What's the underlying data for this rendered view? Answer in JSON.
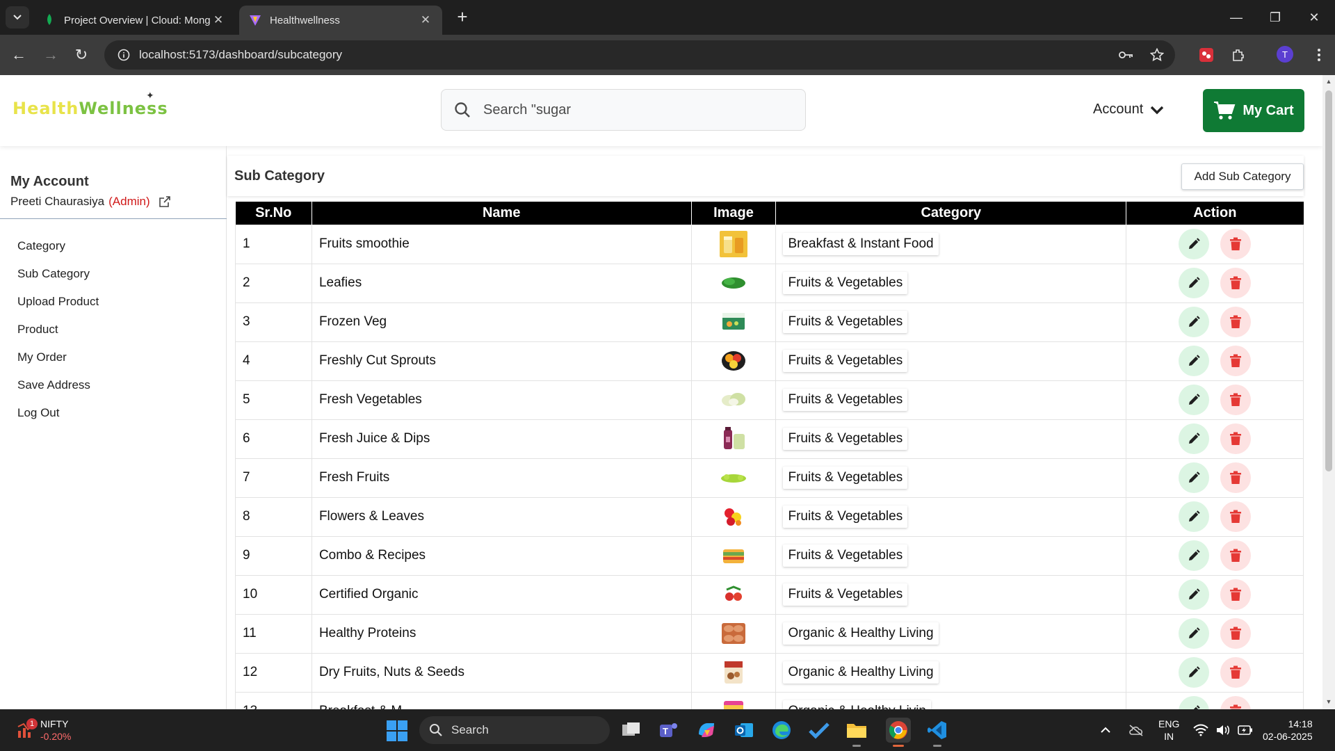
{
  "browser": {
    "tabs": [
      {
        "title": "Project Overview | Cloud: Mong",
        "active": false
      },
      {
        "title": "Healthwellness",
        "active": true
      }
    ],
    "url": "localhost:5173/dashboard/subcategory",
    "profile_initial": "T"
  },
  "header": {
    "logo_part1": "Health",
    "logo_part2": "Wellness",
    "search_placeholder": "Search \"sugar",
    "account_label": "Account",
    "cart_label": "My Cart"
  },
  "sidebar": {
    "title": "My Account",
    "user_name": "Preeti Chaurasiya",
    "user_role": "(Admin)",
    "items": [
      "Category",
      "Sub Category",
      "Upload Product",
      "Product",
      "My Order",
      "Save Address",
      "Log Out"
    ]
  },
  "main": {
    "title": "Sub Category",
    "add_button": "Add Sub Category",
    "columns": [
      "Sr.No",
      "Name",
      "Image",
      "Category",
      "Action"
    ],
    "rows": [
      {
        "sr": "1",
        "name": "Fruits smoothie",
        "category": "Breakfast & Instant Food",
        "image": "smoothie-glasses-image"
      },
      {
        "sr": "2",
        "name": "Leafies",
        "category": "Fruits & Vegetables",
        "image": "leafy-greens-image"
      },
      {
        "sr": "3",
        "name": "Frozen Veg",
        "category": "Fruits & Vegetables",
        "image": "frozen-veg-pack-image"
      },
      {
        "sr": "4",
        "name": "Freshly Cut Sprouts",
        "category": "Fruits & Vegetables",
        "image": "cut-sprouts-image"
      },
      {
        "sr": "5",
        "name": "Fresh Vegetables",
        "category": "Fruits & Vegetables",
        "image": "fresh-vegetables-image"
      },
      {
        "sr": "6",
        "name": "Fresh Juice & Dips",
        "category": "Fruits & Vegetables",
        "image": "juice-bottles-image"
      },
      {
        "sr": "7",
        "name": "Fresh Fruits",
        "category": "Fruits & Vegetables",
        "image": "grapes-image"
      },
      {
        "sr": "8",
        "name": "Flowers & Leaves",
        "category": "Fruits & Vegetables",
        "image": "flowers-image"
      },
      {
        "sr": "9",
        "name": "Combo & Recipes",
        "category": "Fruits & Vegetables",
        "image": "combo-box-image"
      },
      {
        "sr": "10",
        "name": "Certified Organic",
        "category": "Fruits & Vegetables",
        "image": "organic-tomatoes-image"
      },
      {
        "sr": "11",
        "name": "Healthy Proteins",
        "category": "Organic & Healthy Living",
        "image": "eggs-tray-image"
      },
      {
        "sr": "12",
        "name": "Dry Fruits, Nuts & Seeds",
        "category": "Organic & Healthy Living",
        "image": "nuts-pack-image"
      },
      {
        "sr": "13",
        "name": "Breakfast & M",
        "category": "Organic & Healthy Livin",
        "image": "breakfast-pack-image"
      }
    ]
  },
  "taskbar": {
    "widget_badge": "1",
    "widget_name": "NIFTY",
    "widget_change": "-0.20%",
    "search_label": "Search",
    "lang_line1": "ENG",
    "lang_line2": "IN",
    "time": "14:18",
    "date": "02-06-2025"
  },
  "colors": {
    "cart_green": "#0f7a34",
    "admin_red": "#d01919",
    "edit_bg": "#dcf5e3",
    "delete_bg": "#fde2e2",
    "delete_icon": "#e53935"
  }
}
